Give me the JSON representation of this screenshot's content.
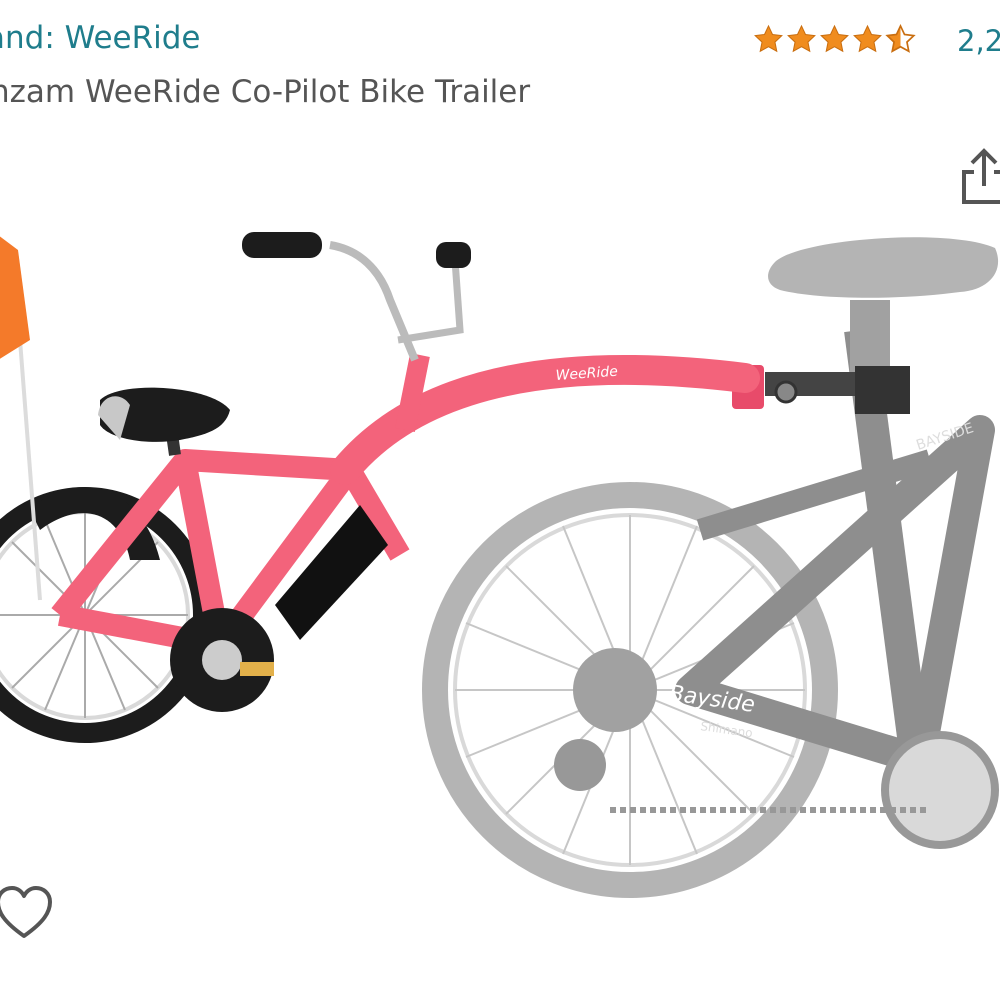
{
  "product": {
    "brand_label": "and: WeeRide",
    "title": "nzam WeeRide Co-Pilot Bike Trailer",
    "rating_count": "2,2",
    "rating": 4.5,
    "rating_max": 5,
    "image": {
      "frame_decal": "WeeRide",
      "adult_bike_brand": "Bayside",
      "adult_bike_top_tube_text": "BAYSIDE",
      "adult_bike_lower_text": "Shimano"
    }
  },
  "icons": {
    "share": "share-icon",
    "wishlist": "heart-outline-icon",
    "star_full": "star-full-icon",
    "star_half": "star-half-icon"
  },
  "colors": {
    "brand_link": "#1f7d8c",
    "star": "#f08c1e",
    "frame": "#f3637b",
    "flag": "#f47a2a"
  }
}
